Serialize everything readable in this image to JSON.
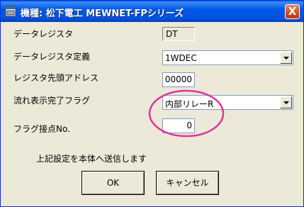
{
  "window": {
    "title": "機種: 松下電工 MEWNET-FPシリーズ",
    "close_label": "X",
    "icons": {
      "app": "app-window-icon",
      "close": "close-icon"
    }
  },
  "form": {
    "data_register": {
      "label": "データレジスタ",
      "value": "DT"
    },
    "data_register_definition": {
      "label": "データレジスタ定義",
      "value": "1WDEC"
    },
    "register_start_address": {
      "label": "レジスタ先頭アドレス",
      "value": "00000"
    },
    "flow_display_complete_flag": {
      "label": "流れ表示完了フラグ",
      "value": "内部リレーR"
    },
    "flag_contact_no": {
      "label": "フラグ接点No.",
      "value": "0"
    }
  },
  "footer": {
    "message": "上記設定を本体へ送信します",
    "ok_label": "OK",
    "cancel_label": "キャンセル"
  },
  "colors": {
    "titlebar": "#0054e3",
    "highlight_ellipse": "#e0339e",
    "dialog_bg": "#ece9d8"
  }
}
